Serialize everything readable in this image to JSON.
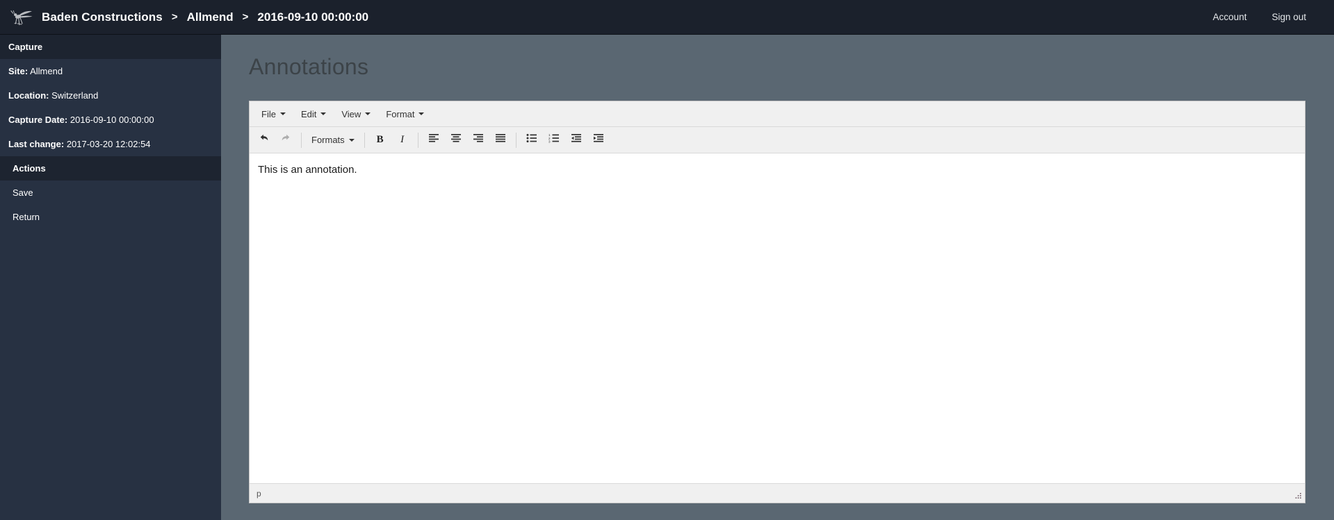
{
  "navbar": {
    "logo_icon": "mosquito-logo-icon",
    "brand": "Baden Constructions",
    "separator": ">",
    "crumb_site": "Allmend",
    "crumb_date": "2016-09-10 00:00:00",
    "account": "Account",
    "sign_out": "Sign out"
  },
  "sidebar": {
    "capture_header": "Capture",
    "info": [
      {
        "label": "Site:",
        "value": "Allmend"
      },
      {
        "label": "Location:",
        "value": "Switzerland"
      },
      {
        "label": "Capture Date:",
        "value": "2016-09-10 00:00:00"
      },
      {
        "label": "Last change:",
        "value": "2017-03-20 12:02:54"
      }
    ],
    "actions_header": "Actions",
    "actions": [
      {
        "label": "Save"
      },
      {
        "label": "Return"
      }
    ]
  },
  "main": {
    "page_title": "Annotations"
  },
  "editor": {
    "menubar": [
      {
        "label": "File",
        "icon": "chevron-down-icon"
      },
      {
        "label": "Edit",
        "icon": "chevron-down-icon"
      },
      {
        "label": "View",
        "icon": "chevron-down-icon"
      },
      {
        "label": "Format",
        "icon": "chevron-down-icon"
      }
    ],
    "toolbar": {
      "undo": "undo-icon",
      "redo": "redo-icon",
      "formats_label": "Formats",
      "bold": "B",
      "italic": "I",
      "align_left": "align-left-icon",
      "align_center": "align-center-icon",
      "align_right": "align-right-icon",
      "align_justify": "align-justify-icon",
      "bullet_list": "bullet-list-icon",
      "numbered_list": "numbered-list-icon",
      "outdent": "outdent-icon",
      "indent": "indent-icon"
    },
    "content": "This is an annotation.",
    "status_path": "p",
    "resize_handle": "resize-grip-icon"
  },
  "colors": {
    "navbar_bg": "#1b212c",
    "sidebar_bg": "#273142",
    "sidebar_header_bg": "#1d2430",
    "main_bg": "#5a6772",
    "editor_chrome": "#f0f0f0",
    "editor_body": "#ffffff",
    "title_text": "#3c4348"
  }
}
